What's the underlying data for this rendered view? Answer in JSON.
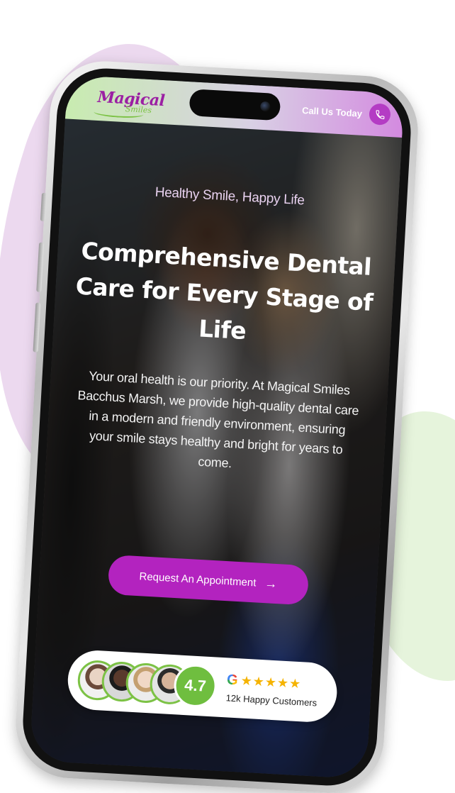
{
  "brand": {
    "logo_main": "Magical",
    "logo_sub": "Smiles",
    "primary_color": "#b323bf",
    "accent_green": "#7cc245"
  },
  "header": {
    "call_label": "Call Us Today",
    "call_icon": "phone-icon"
  },
  "hero": {
    "tagline": "Healthy Smile, Happy Life",
    "headline": "Comprehensive Dental Care for Every Stage of Life",
    "description": "Your oral health is our priority. At Magical Smiles Bacchus Marsh, we provide high-quality dental care in a modern and friendly environment, ensuring your smile stays healthy and bright for years to come.",
    "cta_label": "Request An Appointment",
    "cta_icon": "arrow-right-icon"
  },
  "reviews": {
    "rating": "4.7",
    "provider_icon": "google-icon",
    "stars": "★★★★★",
    "star_color": "#f5b301",
    "customers_label": "12k Happy Customers"
  }
}
